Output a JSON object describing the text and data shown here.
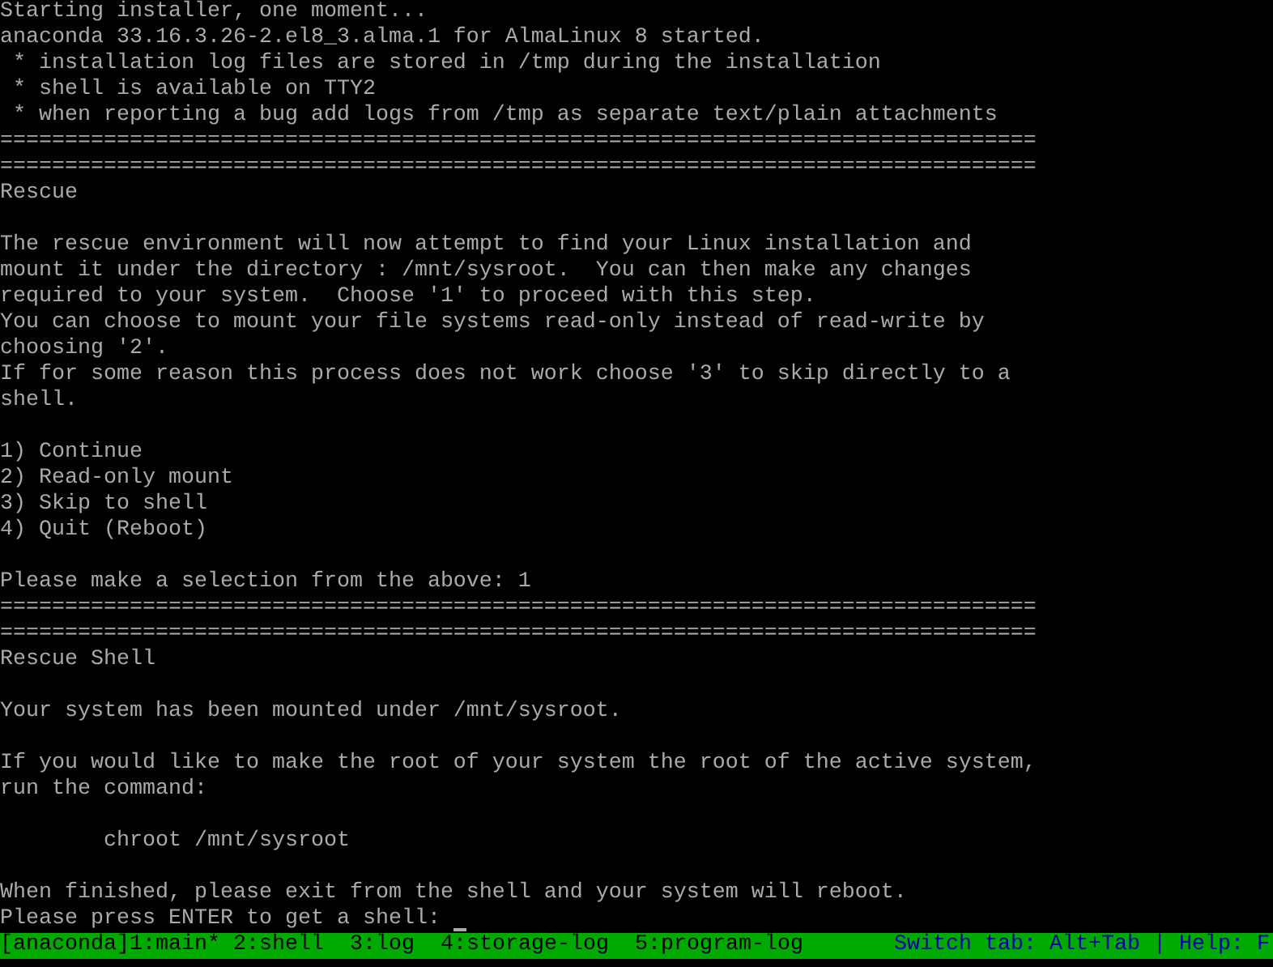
{
  "terminal": {
    "lines": [
      {
        "kind": "text",
        "text": "Starting installer, one moment..."
      },
      {
        "kind": "text",
        "text": "anaconda 33.16.3.26-2.el8_3.alma.1 for AlmaLinux 8 started."
      },
      {
        "kind": "text",
        "text": " * installation log files are stored in /tmp during the installation"
      },
      {
        "kind": "text",
        "text": " * shell is available on TTY2"
      },
      {
        "kind": "text",
        "text": " * when reporting a bug add logs from /tmp as separate text/plain attachments"
      },
      {
        "kind": "rule",
        "text": "================================================================================"
      },
      {
        "kind": "rule",
        "text": "================================================================================"
      },
      {
        "kind": "text",
        "text": "Rescue"
      },
      {
        "kind": "blank"
      },
      {
        "kind": "text",
        "text": "The rescue environment will now attempt to find your Linux installation and"
      },
      {
        "kind": "text",
        "text": "mount it under the directory : /mnt/sysroot.  You can then make any changes"
      },
      {
        "kind": "text",
        "text": "required to your system.  Choose '1' to proceed with this step."
      },
      {
        "kind": "text",
        "text": "You can choose to mount your file systems read-only instead of read-write by"
      },
      {
        "kind": "text",
        "text": "choosing '2'."
      },
      {
        "kind": "text",
        "text": "If for some reason this process does not work choose '3' to skip directly to a"
      },
      {
        "kind": "text",
        "text": "shell."
      },
      {
        "kind": "blank"
      },
      {
        "kind": "text",
        "text": "1) Continue"
      },
      {
        "kind": "text",
        "text": "2) Read-only mount"
      },
      {
        "kind": "text",
        "text": "3) Skip to shell"
      },
      {
        "kind": "text",
        "text": "4) Quit (Reboot)"
      },
      {
        "kind": "blank"
      },
      {
        "kind": "text",
        "text": "Please make a selection from the above: 1"
      },
      {
        "kind": "rule",
        "text": "================================================================================"
      },
      {
        "kind": "rule",
        "text": "================================================================================"
      },
      {
        "kind": "text",
        "text": "Rescue Shell"
      },
      {
        "kind": "blank"
      },
      {
        "kind": "text",
        "text": "Your system has been mounted under /mnt/sysroot."
      },
      {
        "kind": "blank"
      },
      {
        "kind": "text",
        "text": "If you would like to make the root of your system the root of the active system,"
      },
      {
        "kind": "text",
        "text": "run the command:"
      },
      {
        "kind": "blank"
      },
      {
        "kind": "text",
        "text": "        chroot /mnt/sysroot"
      },
      {
        "kind": "blank"
      },
      {
        "kind": "text",
        "text": "When finished, please exit from the shell and your system will reboot."
      },
      {
        "kind": "prompt",
        "text": "Please press ENTER to get a shell: "
      }
    ]
  },
  "status_bar": {
    "session": "[anaconda]",
    "windows": [
      "1:main*",
      "2:shell",
      "3:log",
      "4:storage-log",
      "5:program-log"
    ],
    "hint": "Switch tab: Alt+Tab | Help: F"
  }
}
